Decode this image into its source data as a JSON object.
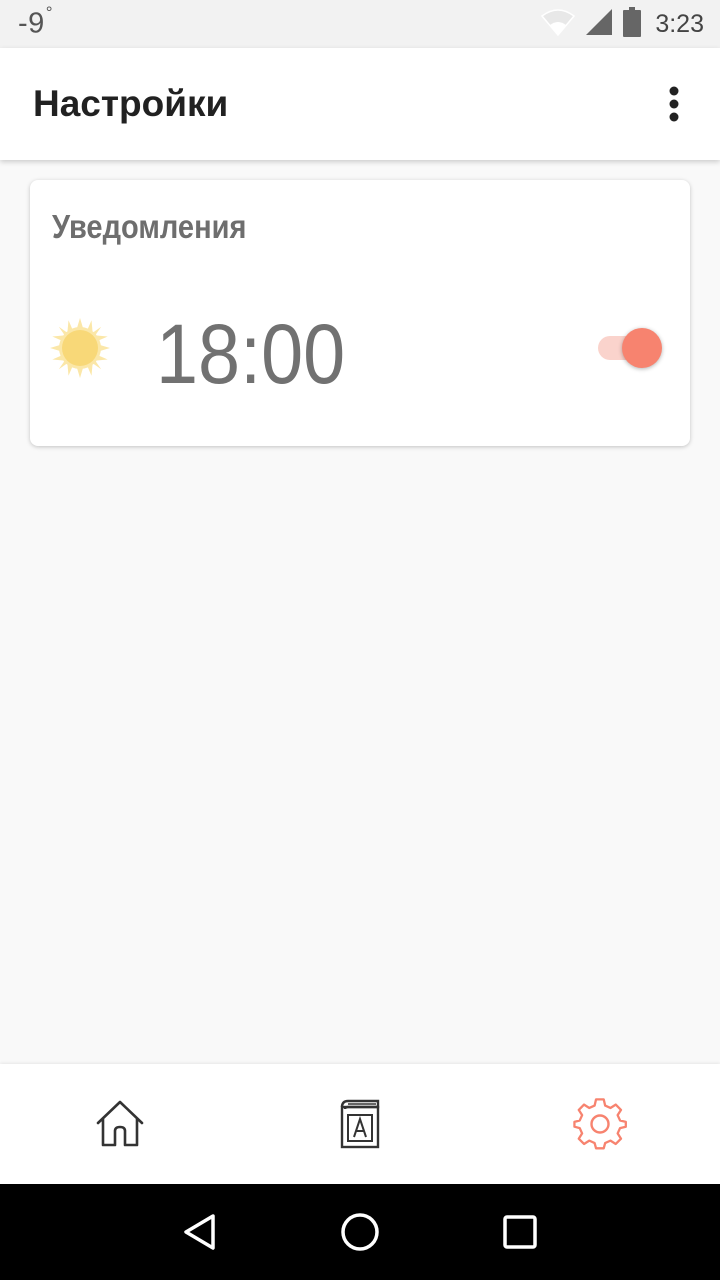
{
  "status_bar": {
    "temperature": "-9",
    "degree": "°",
    "time": "3:23",
    "icons": [
      "wifi-icon",
      "signal-icon",
      "battery-icon"
    ]
  },
  "app_bar": {
    "title": "Настройки",
    "menu_icon": "more-vert-icon"
  },
  "notifications_card": {
    "title": "Уведомления",
    "icon": "sun-icon",
    "time": "18:00",
    "enabled": true,
    "colors": {
      "sun": "#f8d878",
      "toggle_thumb": "#f7836f",
      "toggle_track": "#fad3cc"
    }
  },
  "bottom_nav": {
    "items": [
      {
        "icon": "home-icon",
        "active": false
      },
      {
        "icon": "dictionary-book-icon",
        "active": false
      },
      {
        "icon": "settings-gear-icon",
        "active": true
      }
    ],
    "active_color": "#f7836f",
    "inactive_color": "#333333"
  },
  "system_nav": {
    "buttons": [
      "back-icon",
      "home-circle-icon",
      "recents-square-icon"
    ]
  }
}
